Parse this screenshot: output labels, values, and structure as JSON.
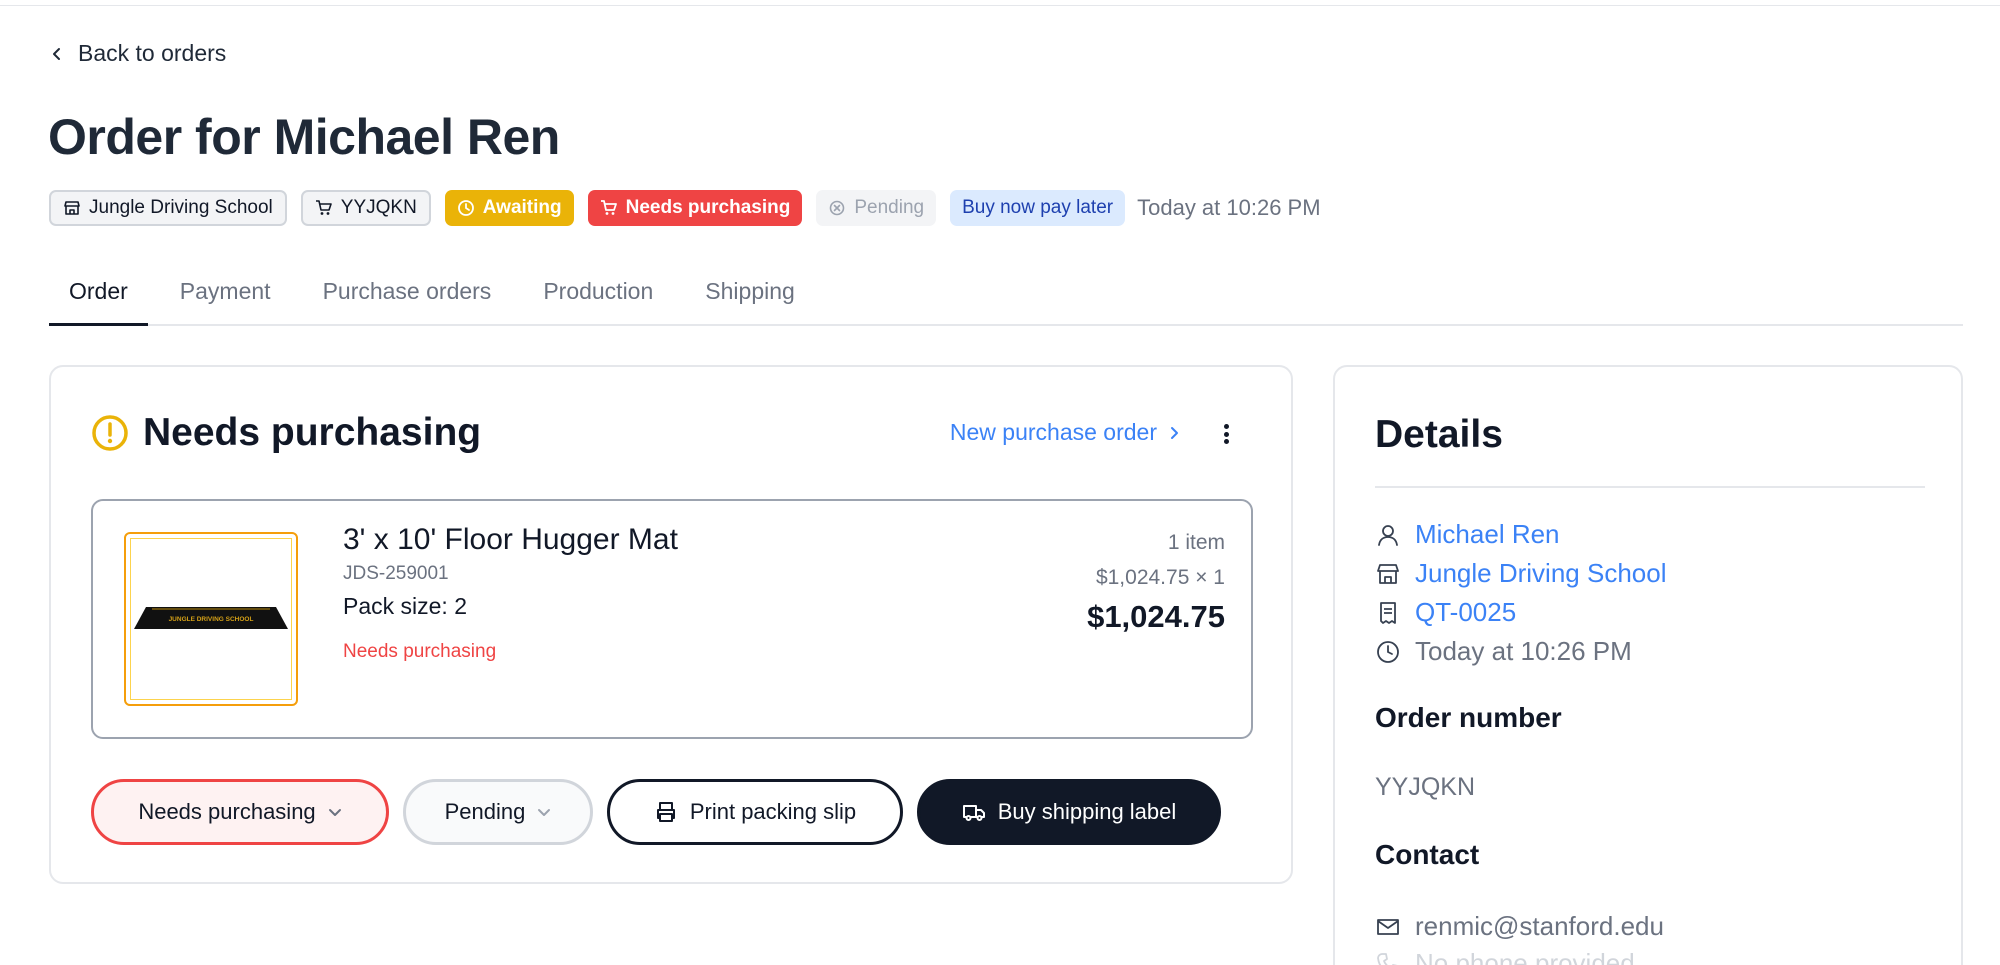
{
  "back_label": "Back to orders",
  "title": "Order for Michael Ren",
  "badges": {
    "school": "Jungle Driving School",
    "order_code": "YYJQKN",
    "awaiting": "Awaiting",
    "needs_purchasing": "Needs purchasing",
    "pending": "Pending",
    "payment_method": "Buy now pay later",
    "timestamp": "Today at 10:26 PM"
  },
  "tabs": [
    "Order",
    "Payment",
    "Purchase orders",
    "Production",
    "Shipping"
  ],
  "card": {
    "title": "Needs purchasing",
    "new_po_label": "New purchase order",
    "item": {
      "name": "3' x 10' Floor Hugger Mat",
      "sku": "JDS-259001",
      "pack": "Pack size: 2",
      "status": "Needs purchasing",
      "count": "1 item",
      "unit_price": "$1,024.75 × 1",
      "total": "$1,024.75",
      "image_text": "JUNGLE DRIVING SCHOOL"
    },
    "actions": {
      "status_select": "Needs purchasing",
      "pending_select": "Pending",
      "print_label": "Print packing slip",
      "buy_label": "Buy shipping label"
    }
  },
  "details": {
    "title": "Details",
    "customer": "Michael Ren",
    "school": "Jungle Driving School",
    "quote": "QT-0025",
    "time": "Today at 10:26 PM",
    "order_number_heading": "Order number",
    "order_number": "YYJQKN",
    "contact_heading": "Contact",
    "email": "renmic@stanford.edu",
    "phone": "No phone provided"
  },
  "colors": {
    "accent_blue": "#3b82f6",
    "danger_red": "#ef4444",
    "warning_yellow": "#eab308",
    "dark": "#111827"
  }
}
